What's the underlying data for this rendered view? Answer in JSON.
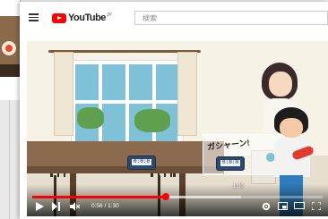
{
  "header": {
    "logo_text": "YouTube",
    "region_label": "JP",
    "search_placeholder": "検索"
  },
  "video": {
    "clock_digits": "0:0:0",
    "bubble_text": "ガシャーン!",
    "hover_time": "1:00",
    "progress_fraction": 0.46,
    "buffer_fraction": 0.72
  },
  "controls": {
    "current_time": "0:56",
    "duration": "1:30",
    "time_separator": " / "
  },
  "colors": {
    "accent": "#ff0000"
  },
  "icons": [
    "menu-icon",
    "youtube-logo-icon",
    "play-icon",
    "next-icon",
    "mute-icon",
    "settings-icon",
    "miniplayer-icon",
    "theater-icon",
    "fullscreen-icon"
  ]
}
